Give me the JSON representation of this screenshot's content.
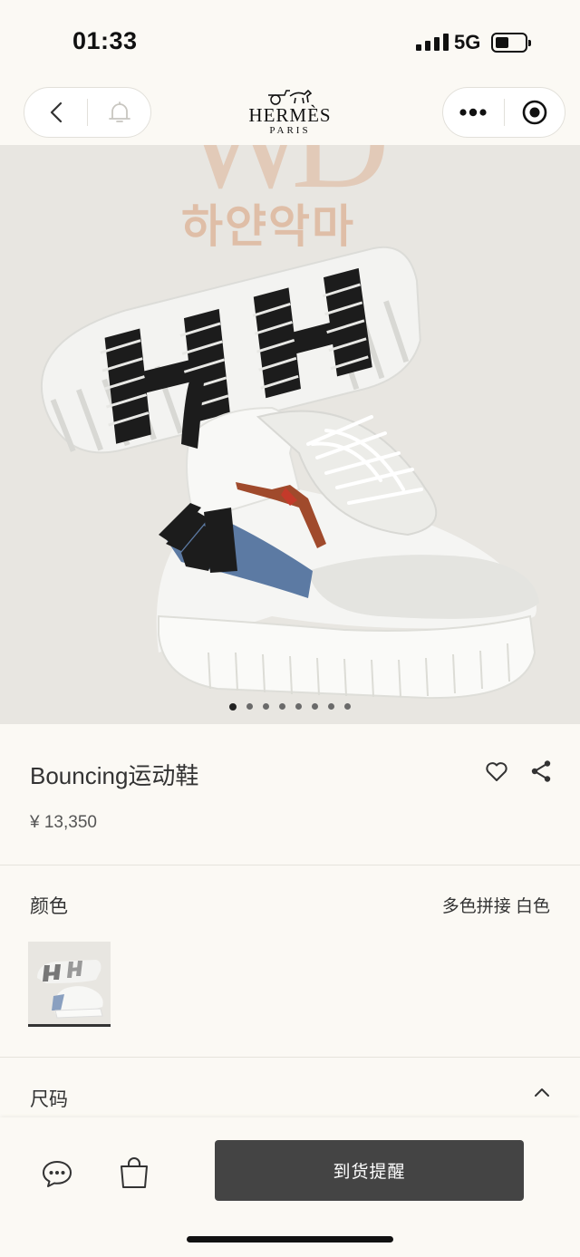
{
  "status_bar": {
    "time": "01:33",
    "network": "5G"
  },
  "nav": {
    "brand": "HERMÈS",
    "brand_city": "PARIS",
    "back_icon": "chevron-left-icon",
    "bell_icon": "bell-icon",
    "more_icon": "more-dots-icon",
    "target_icon": "record-target-icon"
  },
  "hero": {
    "watermark_text": "하얀악마",
    "watermark_logo": "WD",
    "carousel_total": 8,
    "carousel_active": 1
  },
  "product": {
    "name": "Bouncing运动鞋",
    "price": "¥ 13,350"
  },
  "color": {
    "label": "颜色",
    "value": "多色拼接 白色"
  },
  "size": {
    "label": "尺码"
  },
  "bottom_bar": {
    "notify_button": "到货提醒",
    "chat_icon": "chat-bubble-icon",
    "bag_icon": "shopping-bag-icon"
  },
  "colors": {
    "background": "#fbf9f4",
    "hero_bg": "#e8e6e1",
    "button": "#444444"
  }
}
